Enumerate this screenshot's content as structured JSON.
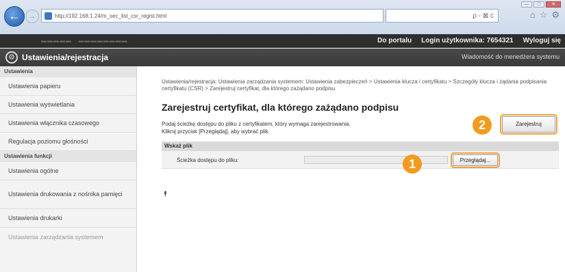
{
  "browser": {
    "url": "http://192.168.1.24/m_sec_list_csr_regist.html",
    "search_placeholder": "ρ - ⊠ ċ"
  },
  "topbar": {
    "portal_link": "Do portalu",
    "login_label": "Login użytkownika:",
    "login_value": "7654321",
    "logout_link": "Wyloguj się"
  },
  "titlebar": {
    "title": "Ustawienia/rejestracja",
    "admin_message": "Wiadomość do menedżera systemu"
  },
  "sidebar": {
    "section1": "Ustawienia",
    "items1": [
      "Ustawienia papieru",
      "Ustawienia wyświetlania",
      "Ustawienia włącznika czasowego",
      "Regulacja poziomu głośności"
    ],
    "section2": "Ustawienia funkcji",
    "items2": [
      "Ustawienia ogólne",
      "Ustawienia drukowania z nośnika pamięci",
      "Ustawienia drukarki"
    ],
    "faded_item": "Ustawienia zarządzania systemem"
  },
  "main": {
    "breadcrumb": "Ustawienia/rejestracja: Ustawienia zarządzania systemem: Ustawienia zabezpieczeń > Ustawienia klucza i certyfikatu > Szczegóły klucza i żądania podpisania certyfikatu (CSR) > Zarejestruj certyfikat, dla którego zażądano podpisu",
    "title": "Zarejestruj certyfikat, dla którego zażądano podpisu",
    "desc_line1": "Podaj ścieżkę dostępu do pliku z certyfikatem, który wymaga zarejestrowania.",
    "desc_line2": "Kliknij przycisk [Przeglądaj], aby wybrać plik.",
    "register_button": "Zarejestruj",
    "section_title": "Wskaż plik",
    "file_path_label": "Ścieżka dostępu do pliku:",
    "browse_button": "Przeglądaj...",
    "badge1": "1",
    "badge2": "2",
    "top_link": "⯭"
  }
}
